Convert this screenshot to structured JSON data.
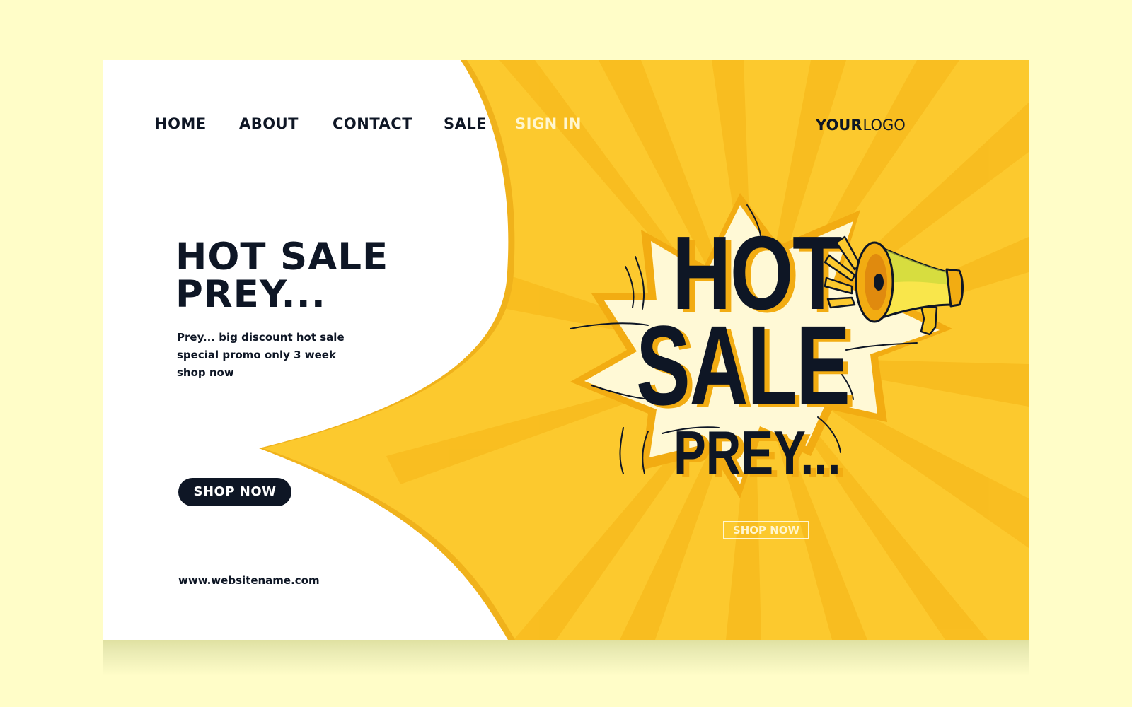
{
  "nav": {
    "items": [
      {
        "label": "HOME"
      },
      {
        "label": "ABOUT"
      },
      {
        "label": "CONTACT"
      },
      {
        "label": "SALE"
      },
      {
        "label": "SIGN IN"
      }
    ]
  },
  "logo": {
    "bold": "YOUR",
    "light": "LOGO"
  },
  "hero": {
    "title_line1": "HOT SALE",
    "title_line2": "PREY...",
    "desc_line1": "Prey... big discount hot sale",
    "desc_line2": "special promo only 3 week",
    "desc_line3": "shop now",
    "button_label": "SHOP NOW",
    "website": "www.websitename.com"
  },
  "promo": {
    "word1": "HOT",
    "word2": "SALE",
    "word3": "PREY...",
    "button_label": "SHOP NOW",
    "icon": "megaphone-icon"
  },
  "colors": {
    "page_bg": "#FFFDC8",
    "yellow": "#FCC92E",
    "yellow_dark": "#F2AC12",
    "navy": "#0E1625",
    "burst_fill": "#FFF9D6"
  }
}
